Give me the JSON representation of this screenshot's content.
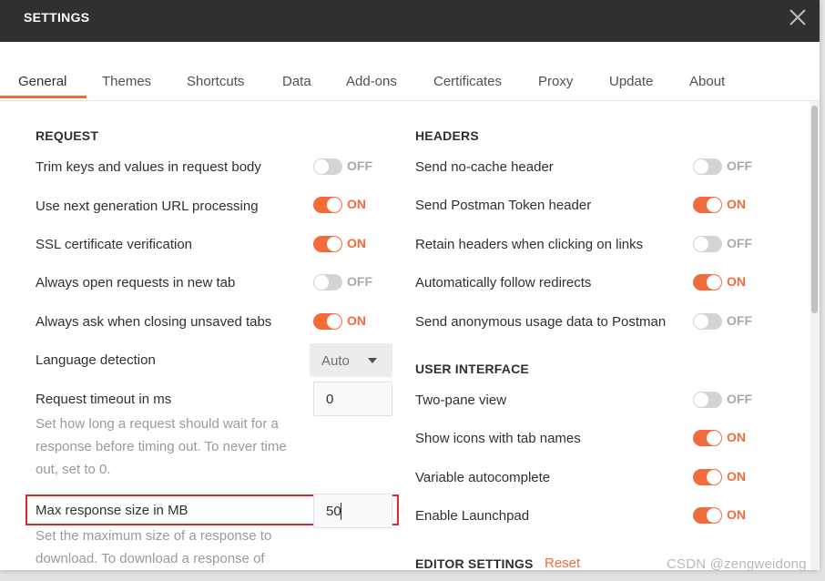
{
  "window": {
    "title": "SETTINGS"
  },
  "tabs": [
    {
      "label": "General"
    },
    {
      "label": "Themes"
    },
    {
      "label": "Shortcuts"
    },
    {
      "label": "Data"
    },
    {
      "label": "Add-ons"
    },
    {
      "label": "Certificates"
    },
    {
      "label": "Proxy"
    },
    {
      "label": "Update"
    },
    {
      "label": "About"
    }
  ],
  "request": {
    "heading": "REQUEST",
    "trim": {
      "label": "Trim keys and values in request body",
      "state": "OFF"
    },
    "url_processing": {
      "label": "Use next generation URL processing",
      "state": "ON"
    },
    "ssl": {
      "label": "SSL certificate verification",
      "state": "ON"
    },
    "new_tab": {
      "label": "Always open requests in new tab",
      "state": "OFF"
    },
    "ask_closing": {
      "label": "Always ask when closing unsaved tabs",
      "state": "ON"
    },
    "language": {
      "label": "Language detection",
      "value": "Auto"
    },
    "timeout": {
      "label": "Request timeout in ms",
      "value": "0",
      "help": "Set how long a request should wait for a response before timing out. To never time out, set to 0."
    },
    "max_size": {
      "label": "Max response size in MB",
      "value": "50",
      "help": "Set the maximum size of a response to download. To download a response of"
    }
  },
  "headers": {
    "heading": "HEADERS",
    "no_cache": {
      "label": "Send no-cache header",
      "state": "OFF"
    },
    "postman_token": {
      "label": "Send Postman Token header",
      "state": "ON"
    },
    "retain_headers": {
      "label": "Retain headers when clicking on links",
      "state": "OFF"
    },
    "follow_redirects": {
      "label": "Automatically follow redirects",
      "state": "ON"
    },
    "anonymous_usage": {
      "label": "Send anonymous usage data to Postman",
      "state": "OFF"
    }
  },
  "user_interface": {
    "heading": "USER INTERFACE",
    "two_pane": {
      "label": "Two-pane view",
      "state": "OFF"
    },
    "tab_icons": {
      "label": "Show icons with tab names",
      "state": "ON"
    },
    "autocomplete": {
      "label": "Variable autocomplete",
      "state": "ON"
    },
    "launchpad": {
      "label": "Enable Launchpad",
      "state": "ON"
    }
  },
  "editor_settings": {
    "heading": "EDITOR SETTINGS",
    "reset_label": "Reset"
  },
  "watermark": "CSDN @zengweidong",
  "colors": {
    "accent": "#f26b3a",
    "titlebar": "#303030",
    "highlight": "#d9292f",
    "toggle_off": "#d4d4d4"
  },
  "icons": {
    "close": "close-icon",
    "dropdown": "chevron-down-icon"
  }
}
